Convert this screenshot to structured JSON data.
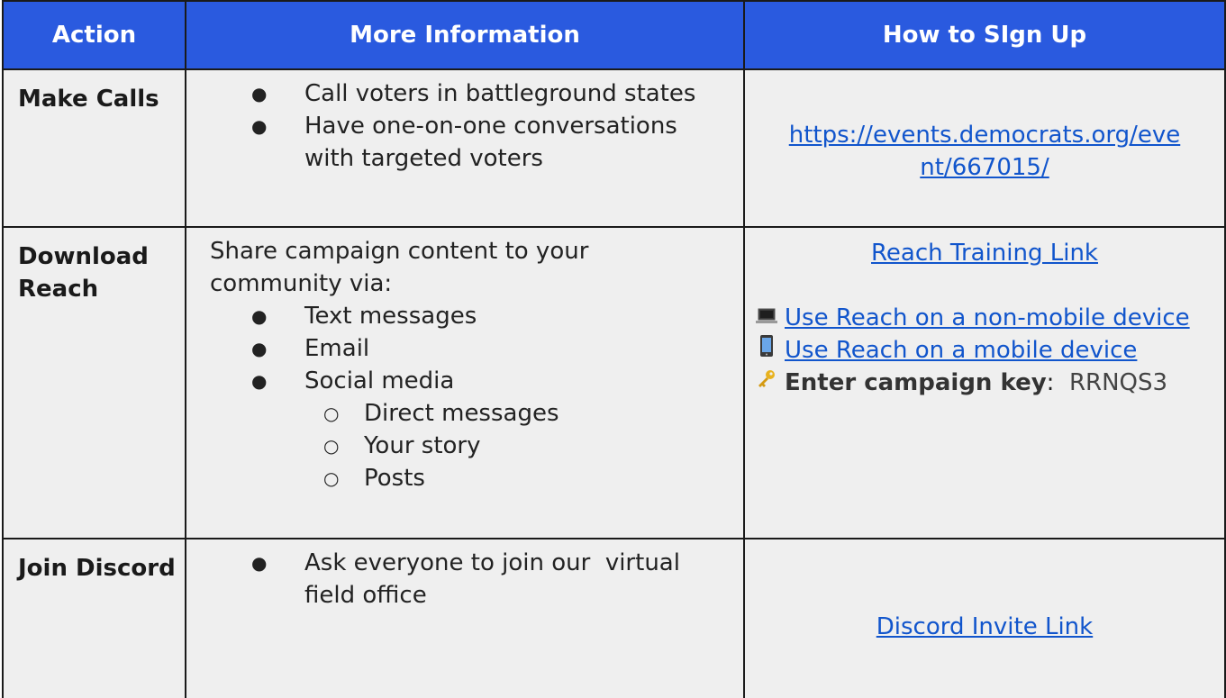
{
  "headers": {
    "action": "Action",
    "info": "More Information",
    "signup": "How to SIgn Up"
  },
  "rows": [
    {
      "action": "Make Calls",
      "bullets": [
        "Call voters in battleground states",
        "Have one-on-one conversations with targeted voters"
      ],
      "link_line1": "https://events.democrats.org/eve",
      "link_line2": "nt/667015/"
    },
    {
      "action": "Download Reach",
      "intro": "Share campaign content to your community via:",
      "bullets": [
        "Text messages",
        "Email",
        "Social media"
      ],
      "sub_bullets": [
        "Direct messages",
        "Your story",
        "Posts"
      ],
      "training_link": "Reach Training Link",
      "laptop_icon": "laptop-icon",
      "phone_icon": "mobile-phone-icon",
      "key_icon": "key-icon",
      "nonmobile_link": "Use Reach on a non-mobile device",
      "mobile_link": "Use Reach on a mobile device",
      "key_label": "Enter campaign key",
      "key_sep": ":",
      "key_value": "RRNQS3"
    },
    {
      "action": "Join Discord",
      "bullets": [
        "Ask everyone to join our  virtual field office"
      ],
      "link": "Discord Invite Link"
    }
  ]
}
